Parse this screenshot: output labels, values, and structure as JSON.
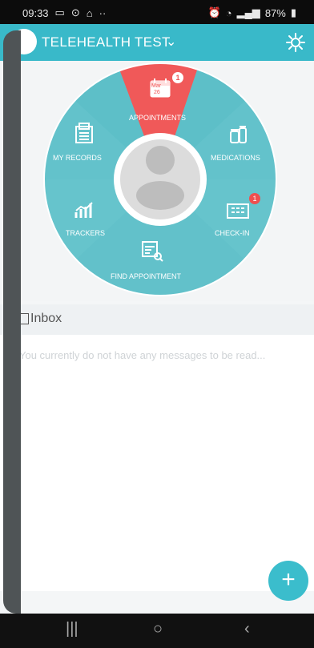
{
  "statusbar": {
    "time": "09:33",
    "battery": "87%"
  },
  "appbar": {
    "title": "TELEHEALTH TEST"
  },
  "wheel": {
    "appointments": "APPOINTMENTS",
    "appointments_date_month": "Mar",
    "appointments_date_day": "26",
    "appointments_badge": "1",
    "my_records": "MY RECORDS",
    "medications": "MEDICATIONS",
    "trackers": "TRACKERS",
    "check_in": "CHECK-IN",
    "check_in_badge": "1",
    "find_appointment": "FIND APPOINTMENT"
  },
  "inbox": {
    "label": "Inbox",
    "empty_message": "You currently do not have any messages to be read..."
  },
  "fab": {
    "label": "+"
  }
}
